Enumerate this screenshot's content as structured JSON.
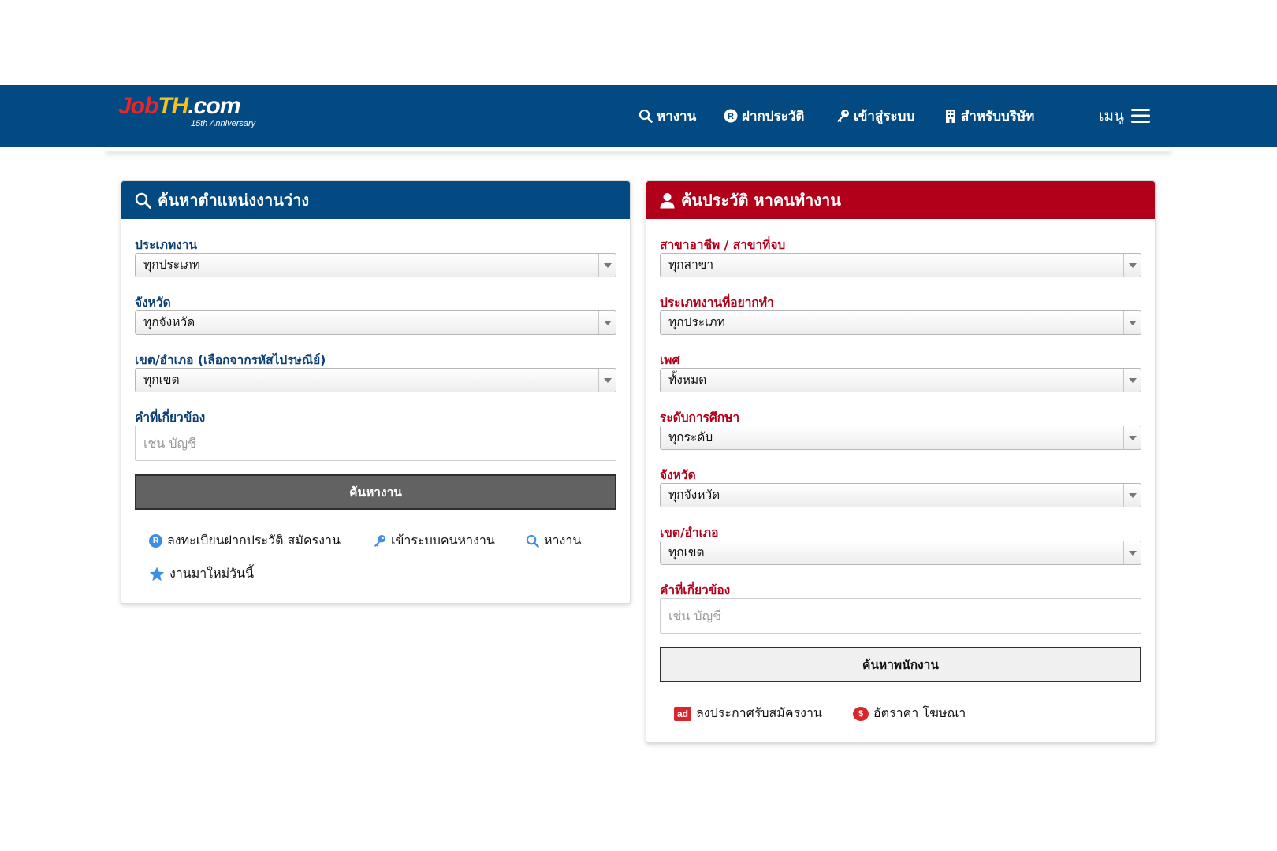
{
  "header": {
    "logo": {
      "job": "Job",
      "th": "TH",
      "com": ".com",
      "tagline": "15th Anniversary"
    },
    "nav": {
      "search": "หางาน",
      "resume": "ฝากประวัติ",
      "login": "เข้าสู่ระบบ",
      "company": "สำหรับบริษัท",
      "menu": "เมนู"
    },
    "colors": {
      "bar": "#044a82"
    }
  },
  "job_search": {
    "title": "ค้นหาตำแหน่งงานว่าง",
    "job_type_label": "ประเภทงาน",
    "job_type_value": "ทุกประเภท",
    "province_label": "จังหวัด",
    "province_value": "ทุกจังหวัด",
    "district_label": "เขต/อำเภอ (เลือกจากรหัสไปรษณีย์)",
    "district_value": "ทุกเขต",
    "keyword_label": "คำที่เกี่ยวข้อง",
    "keyword_placeholder": "เช่น บัญชี",
    "submit": "ค้นหางาน",
    "links": {
      "register": "ลงทะเบียนฝากประวัติ สมัครงาน",
      "login": "เข้าระบบคนหางาน",
      "search": "หางาน",
      "new_jobs": "งานมาใหม่วันนี้"
    },
    "color": "#044a82"
  },
  "resume_search": {
    "title": "ค้นประวัติ หาคนทำงาน",
    "field_label": "สาขาอาชีพ / สาขาที่จบ",
    "field_value": "ทุกสาขา",
    "job_type_label": "ประเภทงานที่อยากทำ",
    "job_type_value": "ทุกประเภท",
    "gender_label": "เพศ",
    "gender_value": "ทั้งหมด",
    "education_label": "ระดับการศึกษา",
    "education_value": "ทุกระดับ",
    "province_label": "จังหวัด",
    "province_value": "ทุกจังหวัด",
    "district_label": "เขต/อำเภอ",
    "district_value": "ทุกเขต",
    "keyword_label": "คำที่เกี่ยวข้อง",
    "keyword_placeholder": "เช่น บัญชี",
    "submit": "ค้นหาพนักงาน",
    "links": {
      "post_job": "ลงประกาศรับสมัครงาน",
      "ad_rates": "อัตราค่า โฆษณา"
    },
    "color": "#b3001a"
  }
}
